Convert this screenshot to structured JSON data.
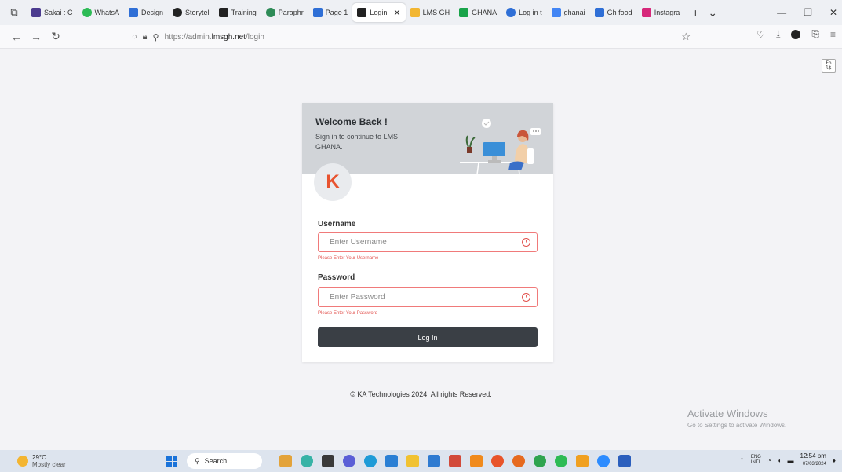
{
  "browser": {
    "tabs": [
      {
        "label": "Sakai : C",
        "icon": "sakai-icon",
        "color": "#4b3b8f",
        "round": false,
        "active": false
      },
      {
        "label": "WhatsA",
        "icon": "whatsapp-icon",
        "color": "#2dbb55",
        "round": true,
        "active": false
      },
      {
        "label": "Design",
        "icon": "slides-icon",
        "color": "#2f6fd6",
        "round": false,
        "active": false
      },
      {
        "label": "Storytel",
        "icon": "storytel-icon",
        "color": "#222222",
        "round": true,
        "active": false
      },
      {
        "label": "Training",
        "icon": "training-icon",
        "color": "#222222",
        "round": false,
        "active": false
      },
      {
        "label": "Paraphr",
        "icon": "paraphrase-icon",
        "color": "#2e8b57",
        "round": true,
        "active": false
      },
      {
        "label": "Page 1",
        "icon": "page-icon",
        "color": "#2f6fd6",
        "round": false,
        "active": false
      },
      {
        "label": "Login",
        "icon": "lms-icon",
        "color": "#222222",
        "round": false,
        "active": true
      },
      {
        "label": "LMS GH",
        "icon": "lms-gh-icon",
        "color": "#f2b632",
        "round": false,
        "active": false
      },
      {
        "label": "GHANA",
        "icon": "sheets-icon",
        "color": "#19a34a",
        "round": false,
        "active": false
      },
      {
        "label": "Log in t",
        "icon": "login-site-icon",
        "color": "#2f6fd6",
        "round": true,
        "active": false
      },
      {
        "label": "ghanai",
        "icon": "google-icon",
        "color": "#4285f4",
        "round": false,
        "active": false
      },
      {
        "label": "Gh food",
        "icon": "docs-icon",
        "color": "#2f6fd6",
        "round": false,
        "active": false
      },
      {
        "label": "Instagra",
        "icon": "instagram-icon",
        "color": "#d6287a",
        "round": false,
        "active": false
      }
    ],
    "url": {
      "prefix": "https://admin.",
      "host": "lmsgh.net",
      "path": "/login"
    }
  },
  "reader_view": "Fo\nl$",
  "login": {
    "title": "Welcome Back !",
    "subtitle": "Sign in to continue to LMS GHANA.",
    "logo_letter": "K",
    "username_label": "Username",
    "username_placeholder": "Enter Username",
    "username_error": "Please Enter Your Username",
    "password_label": "Password",
    "password_placeholder": "Enter Password",
    "password_error": "Please Enter Your Password",
    "login_button": "Log In",
    "warn_symbol": "!"
  },
  "footer": "© KA Technologies 2024. All rights Reserved.",
  "activate": {
    "title": "Activate Windows",
    "sub": "Go to Settings to activate Windows."
  },
  "taskbar": {
    "temperature": "29°C",
    "weather": "Mostly clear",
    "search_label": "Search",
    "apps": [
      {
        "icon": "photos-icon",
        "color": "#e3a33a",
        "round": false
      },
      {
        "icon": "copilot-icon",
        "color": "#38b3a6",
        "round": true
      },
      {
        "icon": "task-view-icon",
        "color": "#3a3a3a",
        "round": false
      },
      {
        "icon": "chat-icon",
        "color": "#5a5fd6",
        "round": true
      },
      {
        "icon": "edge-icon",
        "color": "#1e9bd7",
        "round": true
      },
      {
        "icon": "store-icon",
        "color": "#2a7fd4",
        "round": false
      },
      {
        "icon": "file-explorer-icon",
        "color": "#f1c232",
        "round": false
      },
      {
        "icon": "mail-icon",
        "color": "#2f7bd1",
        "round": false
      },
      {
        "icon": "excel-icon",
        "color": "#d24a3a",
        "round": false
      },
      {
        "icon": "vlc-icon",
        "color": "#f08a1c",
        "round": false
      },
      {
        "icon": "brave-icon",
        "color": "#e8542a",
        "round": true
      },
      {
        "icon": "firefox-icon",
        "color": "#e66a1f",
        "round": true
      },
      {
        "icon": "chrome-icon",
        "color": "#2ea44f",
        "round": true
      },
      {
        "icon": "whatsapp-taskbar-icon",
        "color": "#2dbb55",
        "round": true
      },
      {
        "icon": "warning-app-icon",
        "color": "#f0a020",
        "round": false
      },
      {
        "icon": "zoom-icon",
        "color": "#2d8cff",
        "round": true
      },
      {
        "icon": "word-icon",
        "color": "#2b5fbd",
        "round": false
      }
    ],
    "lang_top": "ENG",
    "lang_bottom": "INTL",
    "time": "12:54 pm",
    "date": "07/03/2024"
  }
}
